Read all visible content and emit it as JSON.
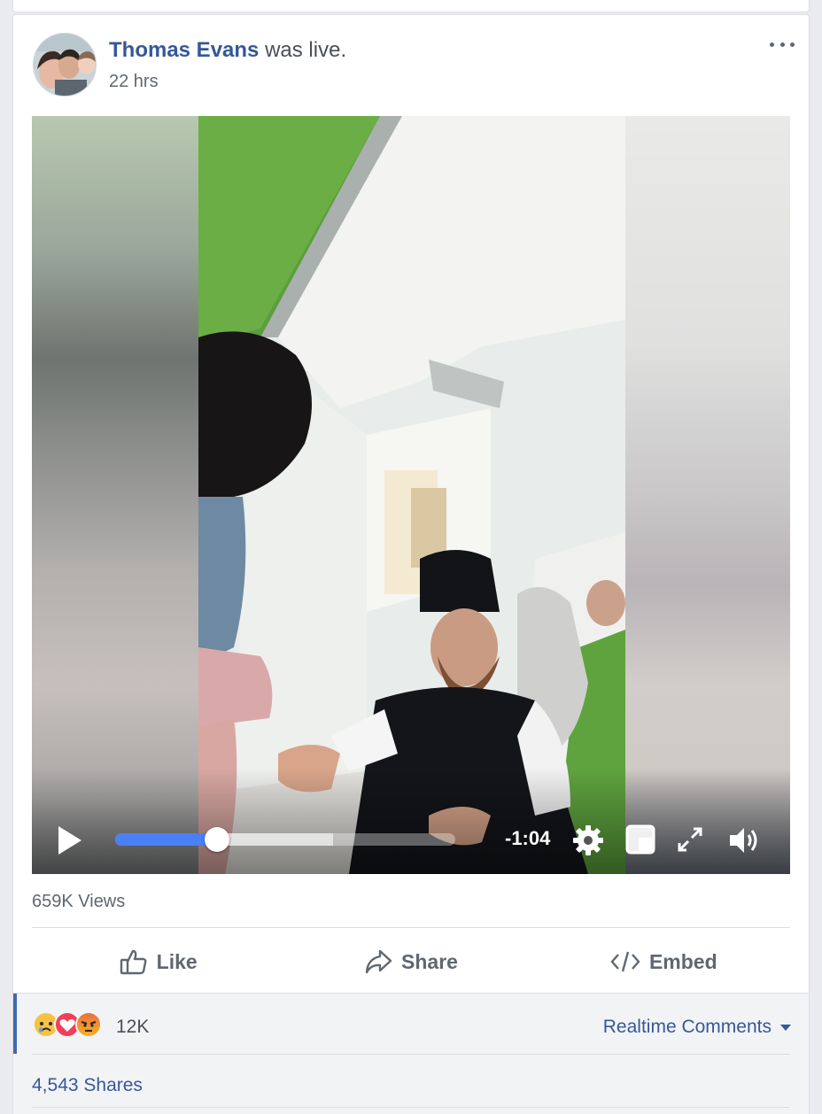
{
  "post": {
    "author_name": "Thomas Evans",
    "author_action": "was live.",
    "timestamp": "22 hrs",
    "more_icon": "ellipsis-icon"
  },
  "video": {
    "time_remaining": "-1:04",
    "progress_fraction": 0.3,
    "buffered_fraction": 0.64,
    "controls": {
      "play_icon": "play-icon",
      "settings_icon": "gear-icon",
      "pip_icon": "picture-in-picture-icon",
      "fullscreen_icon": "fullscreen-icon",
      "volume_icon": "volume-icon"
    }
  },
  "stats": {
    "views": "659K Views",
    "reaction_count": "12K",
    "reactions": [
      "sad",
      "love",
      "angry"
    ],
    "shares": "4,543 Shares"
  },
  "actions": {
    "like_label": "Like",
    "share_label": "Share",
    "embed_label": "Embed"
  },
  "comments_filter": {
    "label": "Realtime Comments"
  },
  "colors": {
    "link_blue": "#365899",
    "progress_blue": "#4a80f5",
    "accent_bar": "#4267b2"
  }
}
